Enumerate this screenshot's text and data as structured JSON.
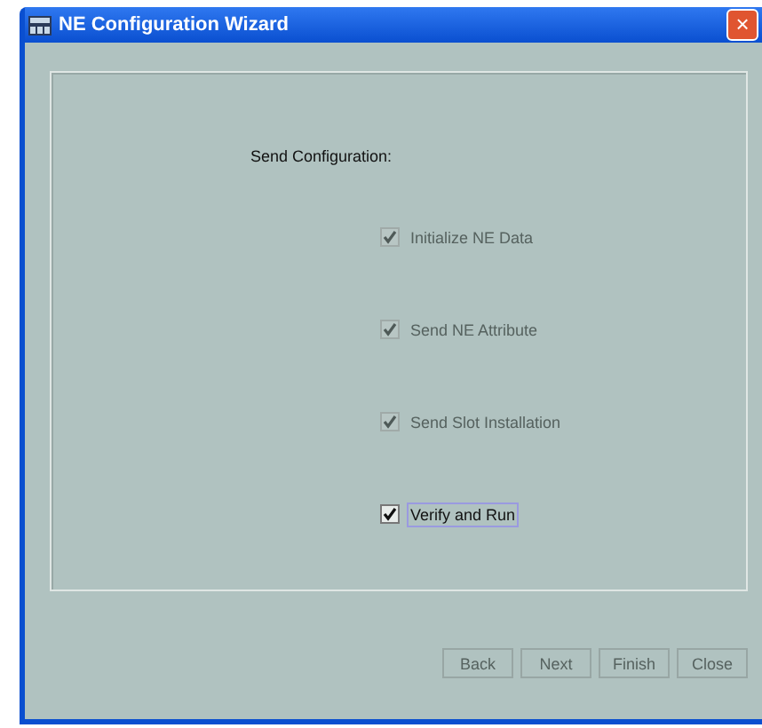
{
  "window": {
    "title": "NE Configuration Wizard",
    "close_icon": "×"
  },
  "heading": "Send Configuration:",
  "options": [
    {
      "label": "Initialize NE Data",
      "checked": true,
      "disabled": true,
      "focused": false
    },
    {
      "label": "Send NE Attribute",
      "checked": true,
      "disabled": true,
      "focused": false
    },
    {
      "label": "Send Slot Installation",
      "checked": true,
      "disabled": true,
      "focused": false
    },
    {
      "label": "Verify and Run",
      "checked": true,
      "disabled": false,
      "focused": true
    }
  ],
  "buttons": [
    {
      "label": "Back",
      "disabled": true
    },
    {
      "label": "Next",
      "disabled": true
    },
    {
      "label": "Finish",
      "disabled": true
    },
    {
      "label": "Close",
      "disabled": true
    }
  ]
}
